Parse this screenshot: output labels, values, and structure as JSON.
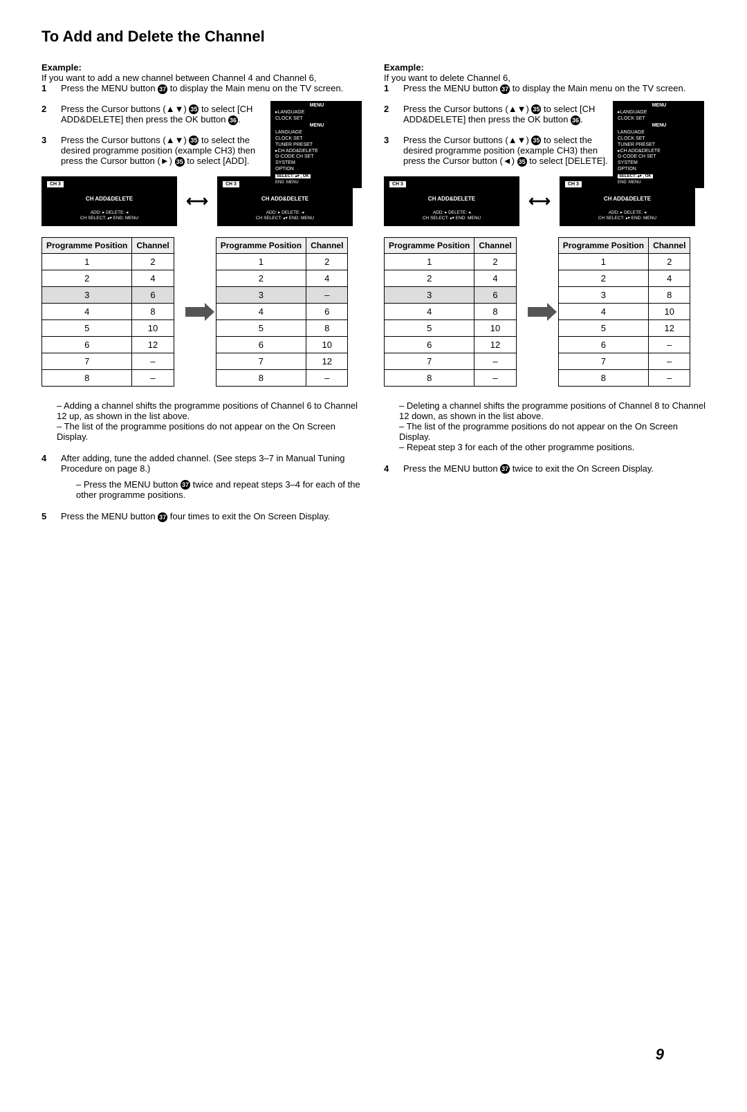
{
  "sectionTitle": "To Add and Delete the Channel",
  "add": {
    "exampleLabel": "Example:",
    "intro": "If you want to add a new channel between Channel 4 and Channel 6,",
    "steps": [
      {
        "n": "1",
        "textA": "Press the MENU button ",
        "btn": "37",
        "textB": " to display the Main menu on the TV screen."
      },
      {
        "n": "2",
        "textA": "Press the Cursor buttons (▲▼) ",
        "btn": "35",
        "textB": " to select [CH ADD&DELETE] then press the OK button ",
        "btn2": "36",
        "textC": "."
      },
      {
        "n": "3",
        "textA": "Press the Cursor buttons (▲▼) ",
        "btn": "35",
        "textB": " to select the desired programme position (example CH3) then press the Cursor button (►) ",
        "btn2": "35",
        "textC": " to select [ADD]."
      }
    ],
    "osdLeft": {
      "chan": "CH 3",
      "line": "CH ADD&DELETE",
      "foot1": "ADD: ▸   DELETE: ◂",
      "foot2": "CH SELECT: ▴▾      END: MENU"
    },
    "osdRight": {
      "chan": "CH 3",
      "line": "CH ADD&DELETE",
      "foot1": "ADD: ▸   DELETE: ◂",
      "foot2": "CH SELECT: ▴▾      END: MENU"
    },
    "tableBefore": {
      "head1": "Programme Position",
      "head2": "Channel",
      "rows": [
        [
          "1",
          "2"
        ],
        [
          "2",
          "4"
        ],
        [
          "3",
          "6"
        ],
        [
          "4",
          "8"
        ],
        [
          "5",
          "10"
        ],
        [
          "6",
          "12"
        ],
        [
          "7",
          "–"
        ],
        [
          "8",
          "–"
        ]
      ],
      "hl": 2
    },
    "tableAfter": {
      "head1": "Programme Position",
      "head2": "Channel",
      "rows": [
        [
          "1",
          "2"
        ],
        [
          "2",
          "4"
        ],
        [
          "3",
          "–"
        ],
        [
          "4",
          "6"
        ],
        [
          "5",
          "8"
        ],
        [
          "6",
          "10"
        ],
        [
          "7",
          "12"
        ],
        [
          "8",
          "–"
        ]
      ],
      "hl": 2
    },
    "notes": [
      "Adding a channel shifts the programme positions of Channel 6 to Channel 12 up, as shown in the list above.",
      "The list of the programme positions do not appear on the On Screen Display."
    ],
    "step4": {
      "n": "4",
      "text": "After adding, tune the added channel. (See steps 3–7 in Manual Tuning Procedure on page 8.)",
      "sub": "Press the MENU button ",
      "btn": "37",
      "sub2": " twice and repeat steps 3–4 for each of the other programme positions."
    },
    "step5": {
      "n": "5",
      "textA": "Press the MENU button ",
      "btn": "37",
      "textB": " four times to exit the On Screen Display."
    }
  },
  "del": {
    "exampleLabel": "Example:",
    "intro": "If you want to delete Channel 6,",
    "steps": [
      {
        "n": "1",
        "textA": "Press the MENU button ",
        "btn": "37",
        "textB": " to display the Main menu on the TV screen."
      },
      {
        "n": "2",
        "textA": "Press the Cursor buttons (▲▼) ",
        "btn": "35",
        "textB": " to select [CH ADD&DELETE] then press the OK button ",
        "btn2": "36",
        "textC": "."
      },
      {
        "n": "3",
        "textA": "Press the Cursor buttons (▲▼) ",
        "btn": "35",
        "textB": " to select the desired programme position (example CH3) then press the Cursor button (◄) ",
        "btn2": "35",
        "textC": " to select [DELETE]."
      }
    ],
    "osdLeft": {
      "chan": "CH 3",
      "line": "CH ADD&DELETE",
      "foot1": "ADD: ▸   DELETE: ◂",
      "foot2": "CH SELECT: ▴▾      END: MENU"
    },
    "osdRight": {
      "chan": "CH 3",
      "line": "CH ADD&DELETE",
      "foot1": "ADD: ▸   DELETE: ◂",
      "foot2": "CH SELECT: ▴▾      END: MENU"
    },
    "tableBefore": {
      "head1": "Programme Position",
      "head2": "Channel",
      "rows": [
        [
          "1",
          "2"
        ],
        [
          "2",
          "4"
        ],
        [
          "3",
          "6"
        ],
        [
          "4",
          "8"
        ],
        [
          "5",
          "10"
        ],
        [
          "6",
          "12"
        ],
        [
          "7",
          "–"
        ],
        [
          "8",
          "–"
        ]
      ],
      "hl": 2
    },
    "tableAfter": {
      "head1": "Programme Position",
      "head2": "Channel",
      "rows": [
        [
          "1",
          "2"
        ],
        [
          "2",
          "4"
        ],
        [
          "3",
          "8"
        ],
        [
          "4",
          "10"
        ],
        [
          "5",
          "12"
        ],
        [
          "6",
          "–"
        ],
        [
          "7",
          "–"
        ],
        [
          "8",
          "–"
        ]
      ],
      "hl": -1
    },
    "notes": [
      "Deleting a channel shifts the programme positions of Channel 8 to Channel 12 down, as shown in the list above.",
      "The list of the programme positions do not appear on the On Screen Display.",
      "Repeat step 3 for each of the other programme positions."
    ],
    "step4": {
      "n": "4",
      "textA": "Press the MENU button ",
      "btn": "37",
      "textB": " twice to exit the On Screen Display."
    }
  },
  "menu": {
    "title": "MENU",
    "items": [
      "LANGUAGE",
      "CLOCK SET",
      "TUNER PRESET",
      "CH ADD&DELETE",
      "G-CODE CH SET",
      "SYSTEM",
      "OPTION"
    ],
    "footer1": "SELECT: ▴▾ , OK",
    "footer2": "END      :MENU"
  },
  "pageNum": "9"
}
